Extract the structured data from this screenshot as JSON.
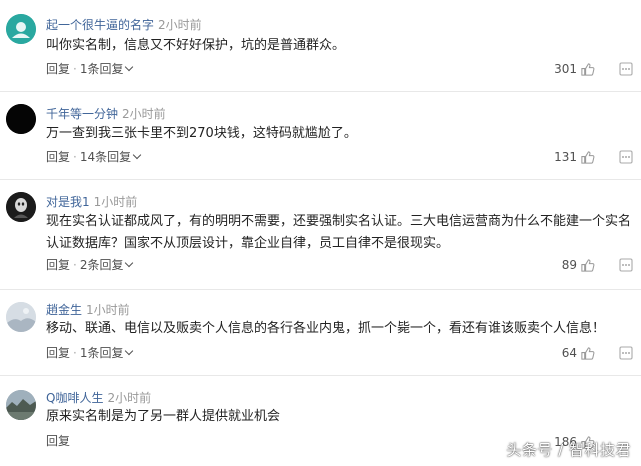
{
  "colors": {
    "username": "#406599",
    "time": "#999999",
    "text": "#222222",
    "action": "#505050",
    "divider": "#e8e8e8"
  },
  "comments": [
    {
      "username": "起一个很牛逼的名字",
      "time": "2小时前",
      "text": "叫你实名制，信息又不好好保护，坑的是普通群众。",
      "reply_label": "回复",
      "replies_label": "1条回复",
      "likes": "301",
      "avatar_icon": "teal-circle-avatar"
    },
    {
      "username": "千年等一分钟",
      "time": "2小时前",
      "text": "万一查到我三张卡里不到270块钱，这特码就尴尬了。",
      "reply_label": "回复",
      "replies_label": "14条回复",
      "likes": "131",
      "avatar_icon": "black-circle-avatar"
    },
    {
      "username": "对是我1",
      "time": "1小时前",
      "text": "现在实名认证都成风了，有的明明不需要，还要强制实名认证。三大电信运营商为什么不能建一个实名认证数据库？国家不从顶层设计，靠企业自律，员工自律不是很现实。",
      "reply_label": "回复",
      "replies_label": "2条回复",
      "likes": "89",
      "avatar_icon": "dark-photo-avatar"
    },
    {
      "username": "趙金生",
      "time": "1小时前",
      "text": "移动、联通、电信以及贩卖个人信息的各行各业内鬼，抓一个毙一个，看还有谁该贩卖个人信息！",
      "reply_label": "回复",
      "replies_label": "1条回复",
      "likes": "64",
      "avatar_icon": "light-photo-avatar"
    },
    {
      "username": "Q咖啡人生",
      "time": "2小时前",
      "text": "原来实名制是为了另一群人提供就业机会",
      "reply_label": "回复",
      "likes": "186",
      "avatar_icon": "landscape-photo-avatar"
    }
  ],
  "watermark": "头条号 / 智科技君"
}
